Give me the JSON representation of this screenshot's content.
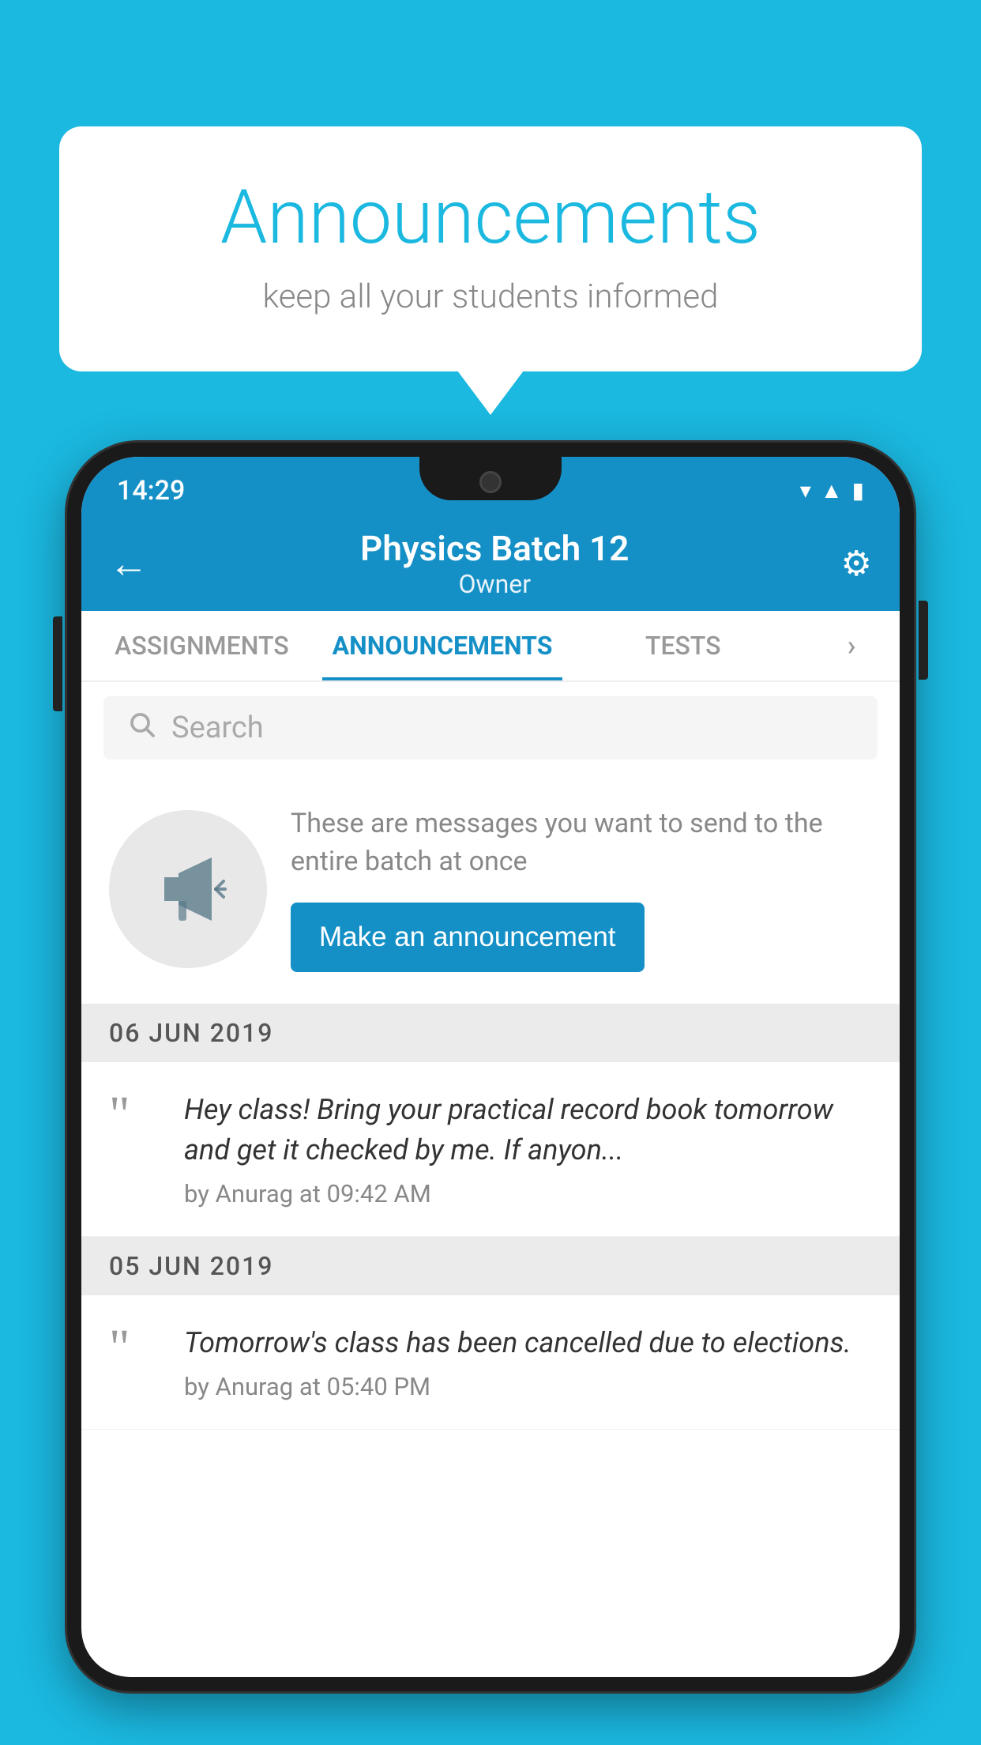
{
  "background_color": "#1BB8E0",
  "speech_bubble": {
    "title": "Announcements",
    "subtitle": "keep all your students informed"
  },
  "phone": {
    "status_bar": {
      "time": "14:29",
      "icons": [
        "wifi",
        "signal",
        "battery"
      ]
    },
    "app_bar": {
      "back_label": "←",
      "title": "Physics Batch 12",
      "subtitle": "Owner",
      "settings_label": "⚙"
    },
    "tabs": [
      {
        "label": "ASSIGNMENTS",
        "active": false
      },
      {
        "label": "ANNOUNCEMENTS",
        "active": true
      },
      {
        "label": "TESTS",
        "active": false
      }
    ],
    "search": {
      "placeholder": "Search"
    },
    "announcement_prompt": {
      "description": "These are messages you want to send to the entire batch at once",
      "button_label": "Make an announcement"
    },
    "announcements": [
      {
        "date": "06  JUN  2019",
        "items": [
          {
            "text": "Hey class! Bring your practical record book tomorrow and get it checked by me. If anyon...",
            "author": "by Anurag at 09:42 AM"
          }
        ]
      },
      {
        "date": "05  JUN  2019",
        "items": [
          {
            "text": "Tomorrow's class has been cancelled due to elections.",
            "author": "by Anurag at 05:40 PM"
          }
        ]
      }
    ]
  }
}
